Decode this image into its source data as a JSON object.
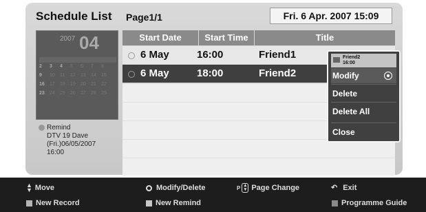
{
  "header": {
    "title": "Schedule List",
    "page": "Page1/1",
    "datetime": "Fri. 6 Apr. 2007 15:09"
  },
  "calendar": {
    "year": "2007",
    "day": "04",
    "rows": [
      [
        "2",
        "3",
        "4",
        "5",
        "6",
        "7",
        "8"
      ],
      [
        "9",
        "10",
        "11",
        "12",
        "13",
        "14",
        "15"
      ],
      [
        "16",
        "17",
        "18",
        "19",
        "20",
        "21",
        "22"
      ],
      [
        "23",
        "24",
        "25",
        "26",
        "27",
        "28",
        "29"
      ]
    ]
  },
  "remind": {
    "label": "Remind",
    "line1": "DTV 19 Dave",
    "line2": "(Fri.)06/05/2007",
    "line3": "16:00"
  },
  "table": {
    "columns": [
      "Start Date",
      "Start Time",
      "Title"
    ],
    "rows": [
      {
        "date": "6 May",
        "time": "16:00",
        "title": "Friend1"
      },
      {
        "date": "6 May",
        "time": "18:00",
        "title": "Friend2"
      }
    ]
  },
  "popup": {
    "title": "Friend2",
    "subtitle": "16:00",
    "items": [
      "Modify",
      "Delete",
      "Delete All",
      "Close"
    ]
  },
  "footer": {
    "move": "Move",
    "modify": "Modify/Delete",
    "p": "P",
    "page_change": "Page Change",
    "exit": "Exit",
    "new_record": "New Record",
    "new_remind": "New Remind",
    "guide": "Programme Guide"
  }
}
